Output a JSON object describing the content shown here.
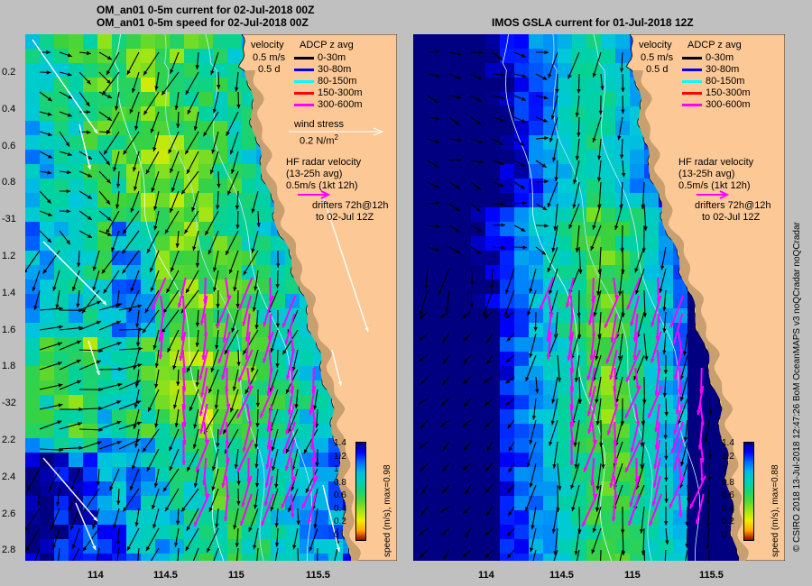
{
  "left_panel": {
    "title_line1": "OM_an01 0-5m current for 02-Jul-2018 00Z",
    "title_line2": "OM_an01 0-5m speed for 02-Jul-2018 00Z",
    "colorbar_label": "speed (m/s), max=0.98",
    "max_speed": 0.98
  },
  "right_panel": {
    "title": "IMOS GSLA current for 01-Jul-2018 12Z",
    "colorbar_label": "speed (m/s), max=0.88",
    "max_speed": 0.88
  },
  "legend": {
    "velocity_title": "velocity",
    "velocity_scale": "0.5 m/s",
    "velocity_time": "0.5 d",
    "adcp_title": "ADCP z avg",
    "adcp_items": [
      {
        "label": "0-30m",
        "color": "#000000"
      },
      {
        "label": "30-80m",
        "color": "#0000ff"
      },
      {
        "label": "80-150m",
        "color": "#00ffff"
      },
      {
        "label": "150-300m",
        "color": "#ff0000"
      },
      {
        "label": "300-600m",
        "color": "#ff00ff"
      }
    ],
    "wind_title": "wind stress",
    "wind_scale": "0.2 N/m",
    "wind_exp": "2",
    "hf_line1": "HF radar velocity",
    "hf_line2": "(13-25h avg)",
    "hf_line3": "0.5m/s (1kt 12h)",
    "drifters_line1": "drifters 72h@12h",
    "drifters_line2": "to 02-Jul 12Z"
  },
  "y_ticks": [
    "0.2",
    "0.4",
    "0.6",
    "0.8",
    "-31",
    "1.2",
    "1.4",
    "1.6",
    "1.8",
    "-32",
    "2.2",
    "2.4",
    "2.6",
    "2.8"
  ],
  "x_ticks": [
    "114",
    "114.5",
    "115",
    "115.5"
  ],
  "colorbar_ticks": [
    "1.4",
    "1.2",
    "1",
    "0.8",
    "0.6",
    "0.4",
    "0.2",
    "0"
  ],
  "credit": "© CSIRO 2018  13-Jul-2018 12:47:26 BoM OceanMAPS v3 noQCradar noQCradar",
  "colors": {
    "land": "#fcc896",
    "coast": "#c8a070",
    "ocean_low": "#000080",
    "ocean_high": "#ffff00"
  }
}
